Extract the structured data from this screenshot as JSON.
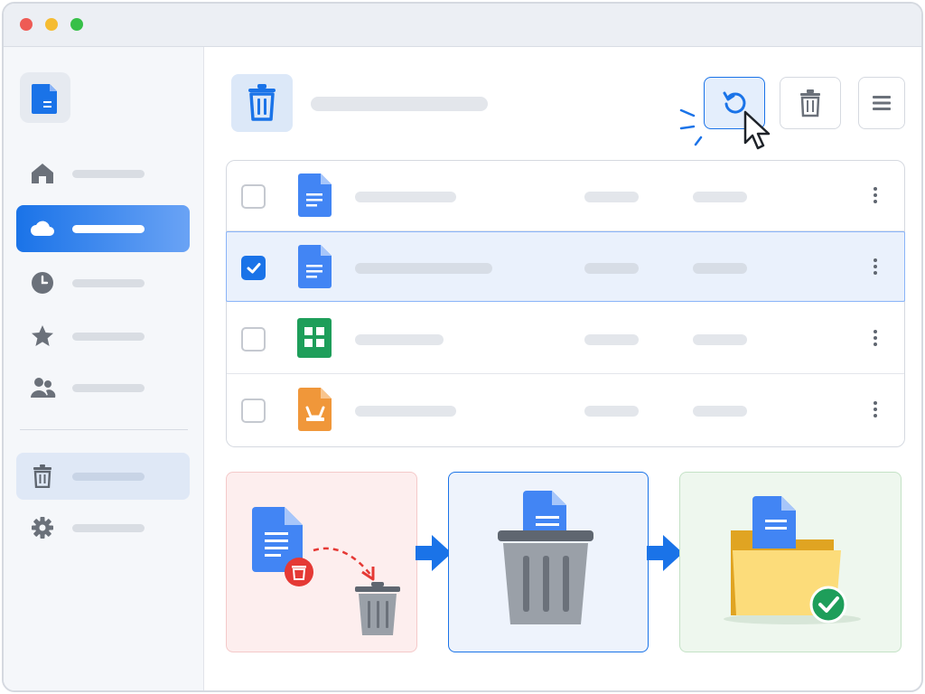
{
  "window": {
    "controls": [
      "close",
      "minimize",
      "maximize"
    ],
    "colors": {
      "close": "#ee5b55",
      "minimize": "#f5bc32",
      "maximize": "#37c048"
    }
  },
  "sidebar": {
    "logo_icon": "document-icon",
    "items": [
      {
        "icon": "home-icon",
        "active": false
      },
      {
        "icon": "cloud-icon",
        "active": true
      },
      {
        "icon": "clock-icon",
        "active": false
      },
      {
        "icon": "star-icon",
        "active": false
      },
      {
        "icon": "people-icon",
        "active": false
      }
    ],
    "bottom_items": [
      {
        "icon": "trash-icon",
        "highlighted": true
      },
      {
        "icon": "gear-icon",
        "highlighted": false
      }
    ]
  },
  "header": {
    "icon": "trash-icon",
    "toolbar": [
      {
        "icon": "restore-icon",
        "highlighted": true
      },
      {
        "icon": "delete-icon",
        "highlighted": false
      },
      {
        "icon": "menu-icon",
        "highlighted": false
      }
    ]
  },
  "files": [
    {
      "type": "document",
      "icon": "document-icon",
      "color": "#4285f4",
      "checked": false
    },
    {
      "type": "document",
      "icon": "document-icon",
      "color": "#4285f4",
      "checked": true
    },
    {
      "type": "spreadsheet",
      "icon": "spreadsheet-icon",
      "color": "#1e9e5a",
      "checked": false
    },
    {
      "type": "slides",
      "icon": "presentation-icon",
      "color": "#f0973a",
      "checked": false
    }
  ],
  "illustration": {
    "steps": [
      {
        "name": "delete-file",
        "background": "#fdeeee",
        "border": "#f4c9c9"
      },
      {
        "name": "in-trash",
        "background": "#eef3fc",
        "border": "#1a73e8"
      },
      {
        "name": "restored",
        "background": "#eef7ee",
        "border": "#c4e2c6"
      }
    ],
    "accent": "#1a73e8",
    "success": "#1e9e5a",
    "danger": "#e53935"
  }
}
